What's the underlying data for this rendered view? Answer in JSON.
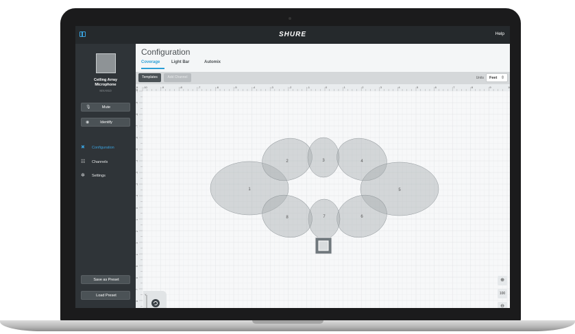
{
  "app": {
    "brand": "SHURE",
    "help": "Help"
  },
  "device": {
    "name_line1": "Ceiling Array",
    "name_line2": "Microphone",
    "model": "MXA910"
  },
  "sidebar": {
    "buttons": [
      {
        "label": "Mute",
        "icon": "mic-icon"
      },
      {
        "label": "Identify",
        "icon": "eye-icon"
      }
    ],
    "nav": [
      {
        "label": "Configuration",
        "icon": "tools-icon",
        "active": true
      },
      {
        "label": "Channels",
        "icon": "sliders-icon",
        "active": false
      },
      {
        "label": "Settings",
        "icon": "gear-icon",
        "active": false
      }
    ],
    "save_preset": "Save as Preset",
    "load_preset": "Load Preset"
  },
  "main": {
    "title": "Configuration",
    "tabs": [
      {
        "label": "Coverage",
        "active": true
      },
      {
        "label": "Light Bar",
        "active": false
      },
      {
        "label": "Automix",
        "active": false
      }
    ],
    "toolbar": {
      "templates": "Templates",
      "add_channel": "Add Channel",
      "units_label": "Units",
      "units_value": "Feet"
    }
  },
  "ruler": {
    "unit": "ft",
    "x_labels": [
      "-10",
      "-9",
      "-8",
      "-7",
      "-6",
      "-5",
      "-4",
      "-3",
      "-2",
      "-1",
      "0",
      "1",
      "2",
      "3",
      "4",
      "5",
      "6",
      "7",
      "8",
      "9",
      "10"
    ],
    "y_labels": [
      "-10",
      "-9",
      "-8",
      "-7",
      "-6",
      "-5",
      "-4",
      "-3",
      "-2",
      "-1",
      "0",
      "1",
      "2",
      "3",
      "4",
      "5",
      "6",
      "7",
      "8",
      "9",
      "10"
    ]
  },
  "lobes": [
    "1",
    "2",
    "3",
    "4",
    "5",
    "6",
    "7",
    "8"
  ],
  "zoom": {
    "in": "⊕",
    "value": "100",
    "out": "⊖"
  },
  "axis": {
    "x": "X",
    "y": "Y",
    "origin": "0"
  },
  "colors": {
    "accent": "#2a9fd6",
    "sidebar": "#2f3438",
    "topbar": "#25292c",
    "lobe_fill": "#a7acaf"
  }
}
